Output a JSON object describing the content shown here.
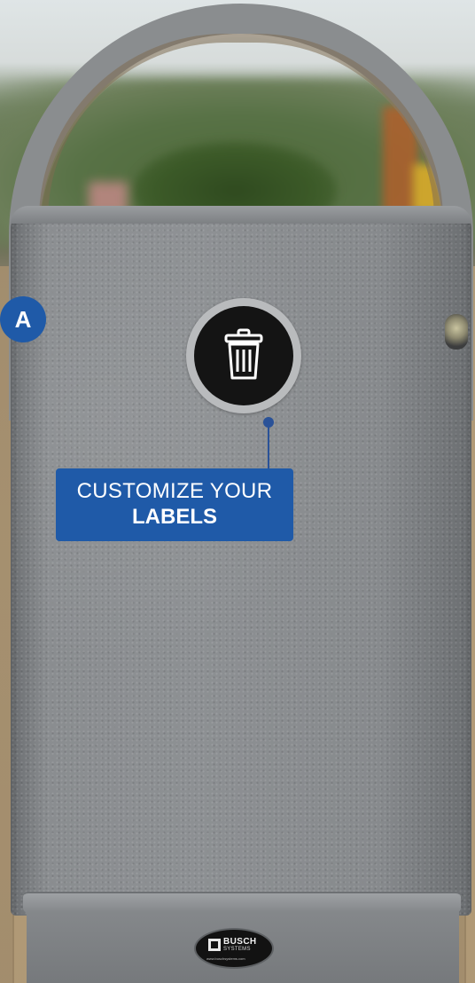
{
  "badge": {
    "letter": "A"
  },
  "callout": {
    "line1": "CUSTOMIZE YOUR",
    "line2": "LABELS"
  },
  "label": {
    "icon": "trash-can-icon"
  },
  "logo": {
    "brand": "BUSCH",
    "sub": "SYSTEMS",
    "url": "www.buschsystems.com"
  },
  "colors": {
    "accent_blue": "#1f5aa8",
    "bin_gray": "#8a8d90",
    "label_black": "#141414"
  }
}
